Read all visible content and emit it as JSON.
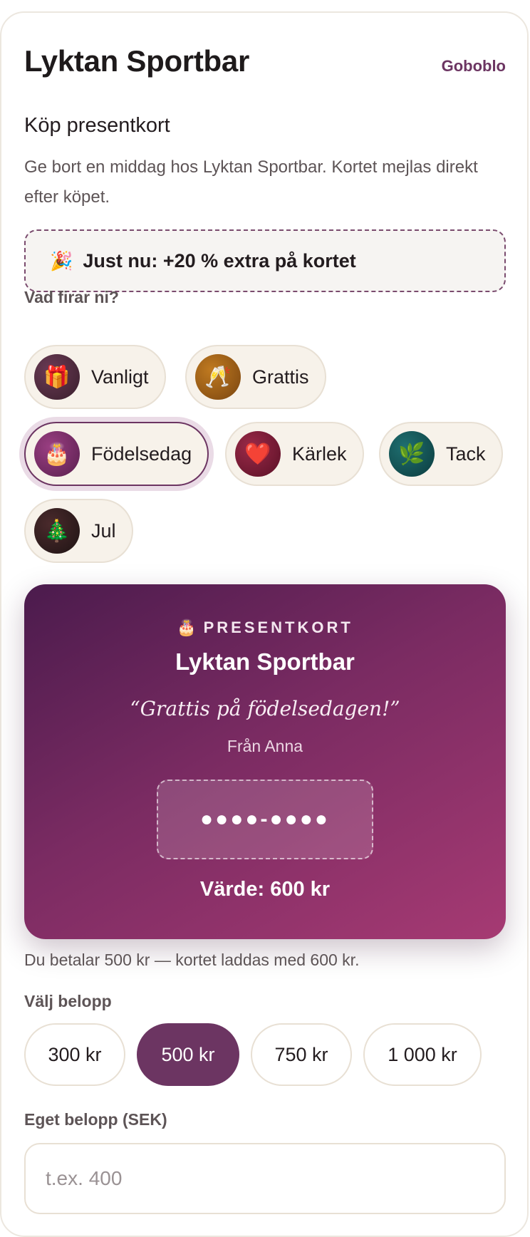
{
  "header": {
    "title": "Lyktan Sportbar",
    "brand": "Goboblo"
  },
  "intro": {
    "heading": "Köp presentkort",
    "description": "Ge bort en middag hos Lyktan Sportbar. Kortet mejlas direkt efter köpet."
  },
  "promo": {
    "icon": "🎉",
    "text": "Just nu: +20 % extra på kortet"
  },
  "occasions": {
    "label": "Vad firar ni?",
    "items": [
      {
        "label": "Vanligt",
        "icon": "🎁",
        "icon_name": "gift-icon",
        "selected": false
      },
      {
        "label": "Grattis",
        "icon": "🥂",
        "icon_name": "champagne-icon",
        "selected": false
      },
      {
        "label": "Födelsedag",
        "icon": "🎂",
        "icon_name": "birthday-cake-icon",
        "selected": true
      },
      {
        "label": "Kärlek",
        "icon": "❤️",
        "icon_name": "heart-icon",
        "selected": false
      },
      {
        "label": "Tack",
        "icon": "🌿",
        "icon_name": "leaf-icon",
        "selected": false
      },
      {
        "label": "Jul",
        "icon": "🎄",
        "icon_name": "christmas-tree-icon",
        "selected": false
      }
    ]
  },
  "card": {
    "icon": "🎂",
    "kicker": "PRESENTKORT",
    "name": "Lyktan Sportbar",
    "message": "“Grattis på födelsedagen!”",
    "from": "Från Anna",
    "code": "●●●●-●●●●",
    "value": "Värde: 600 kr"
  },
  "payment_note": "Du betalar 500 kr — kortet laddas med 600 kr.",
  "amount": {
    "label": "Välj belopp",
    "options": [
      "300 kr",
      "500 kr",
      "750 kr",
      "1 000 kr"
    ],
    "selected": "500 kr"
  },
  "custom_amount": {
    "label": "Eget belopp (SEK)",
    "placeholder": "t.ex. 400",
    "value": ""
  },
  "colors": {
    "accent": "#6c3562",
    "chip_bg": "#f7f2ea",
    "card_gradient": [
      "#4b1b4d",
      "#a63a73"
    ],
    "icon_gift": "#4a2a3a",
    "icon_champagne": "#9a5a12",
    "icon_cake": "#6c2a5e",
    "icon_heart": "#6e1a30",
    "icon_leaf": "#0f4f52",
    "icon_tree": "#3a1f22"
  }
}
